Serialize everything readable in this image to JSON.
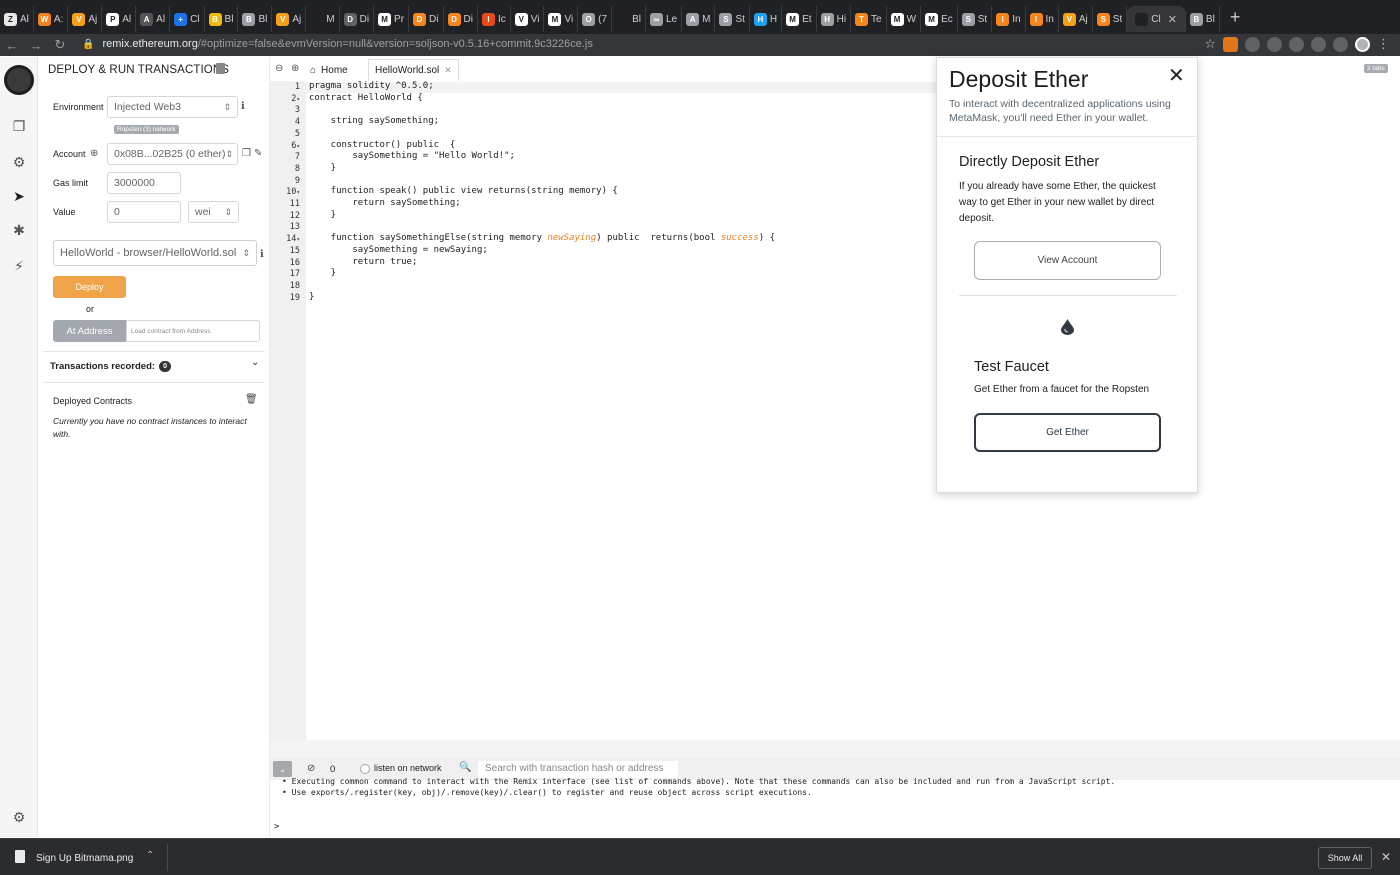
{
  "browser": {
    "tabs": [
      {
        "title": "Al",
        "color": "#e8e8e8",
        "glyph": "Z"
      },
      {
        "title": "A:",
        "color": "#f38020",
        "glyph": "W"
      },
      {
        "title": "Aj",
        "color": "#f6a01a",
        "glyph": "V"
      },
      {
        "title": "Al",
        "color": "#ffffff",
        "glyph": "P"
      },
      {
        "title": "Al",
        "color": "#555555",
        "glyph": "A"
      },
      {
        "title": "Cl",
        "color": "#1a73e8",
        "glyph": "+"
      },
      {
        "title": "Bl",
        "color": "#f0b90b",
        "glyph": "B"
      },
      {
        "title": "Bl",
        "color": "#9aa0a6",
        "glyph": "B"
      },
      {
        "title": "Aj",
        "color": "#f6a01a",
        "glyph": "V"
      },
      {
        "title": "M",
        "color": "#202124",
        "glyph": ""
      },
      {
        "title": "Di",
        "color": "#5f6368",
        "glyph": "D"
      },
      {
        "title": "Pr",
        "color": "#ffffff",
        "glyph": "M"
      },
      {
        "title": "Di",
        "color": "#f6851b",
        "glyph": "D"
      },
      {
        "title": "Di",
        "color": "#f6851b",
        "glyph": "D"
      },
      {
        "title": "Ic",
        "color": "#e64a19",
        "glyph": "I"
      },
      {
        "title": "Vi",
        "color": "#ffffff",
        "glyph": "V"
      },
      {
        "title": "Vi",
        "color": "#ffffff",
        "glyph": "M"
      },
      {
        "title": "(7",
        "color": "#9aa0a6",
        "glyph": "O"
      },
      {
        "title": "Bl",
        "color": "#202124",
        "glyph": ""
      },
      {
        "title": "Le",
        "color": "#9aa0a6",
        "glyph": "∞"
      },
      {
        "title": "M",
        "color": "#9aa0a6",
        "glyph": "A"
      },
      {
        "title": "St",
        "color": "#9aa0a6",
        "glyph": "S"
      },
      {
        "title": "H",
        "color": "#1da1f2",
        "glyph": "H"
      },
      {
        "title": "Et",
        "color": "#ffffff",
        "glyph": "M"
      },
      {
        "title": "Hi",
        "color": "#9aa0a6",
        "glyph": "H"
      },
      {
        "title": "Te",
        "color": "#f6851b",
        "glyph": "T"
      },
      {
        "title": "W",
        "color": "#ffffff",
        "glyph": "M"
      },
      {
        "title": "Ec",
        "color": "#ffffff",
        "glyph": "M"
      },
      {
        "title": "St",
        "color": "#9aa0a6",
        "glyph": "S"
      },
      {
        "title": "In",
        "color": "#f6851b",
        "glyph": "I"
      },
      {
        "title": "In",
        "color": "#f6851b",
        "glyph": "I"
      },
      {
        "title": "Aj",
        "color": "#f6a01a",
        "glyph": "V"
      },
      {
        "title": "St",
        "color": "#f6851b",
        "glyph": "S"
      },
      {
        "title": "Cl",
        "color": "#202124",
        "glyph": ""
      },
      {
        "title": "Bl",
        "color": "#9aa0a6",
        "glyph": "B"
      }
    ],
    "url_host": "remix.ethereum.org",
    "url_path": "/#optimize=false&evmVersion=null&version=soljson-v0.5.16+commit.9c3226ce.js"
  },
  "deploy_panel": {
    "title": "DEPLOY & RUN TRANSACTIONS",
    "environment_label": "Environment",
    "environment_value": "Injected Web3",
    "network_badge": "Ropsten (3) network",
    "account_label": "Account",
    "account_value": "0x08B...02B25 (0 ether)",
    "gas_limit_label": "Gas limit",
    "gas_limit_value": "3000000",
    "value_label": "Value",
    "value_amount": "0",
    "value_unit": "wei",
    "contract_select": "HelloWorld - browser/HelloWorld.sol",
    "deploy_button": "Deploy",
    "or_label": "or",
    "at_address_button": "At Address",
    "at_address_placeholder": "Load contract from Address",
    "transactions_recorded_label": "Transactions recorded:",
    "transactions_recorded_count": "0",
    "deployed_contracts_label": "Deployed Contracts",
    "deployed_contracts_empty": "Currently you have no contract instances to interact with."
  },
  "editor": {
    "home_tab": "Home",
    "file_tab": "HelloWorld.sol",
    "tab_count_badge": "2 tabs",
    "lines": [
      {
        "n": "1",
        "fold": "",
        "parts": [
          {
            "t": "pragma solidity ^0.5.0;",
            "c": ""
          }
        ]
      },
      {
        "n": "2",
        "fold": "▾",
        "parts": [
          {
            "t": "contract HelloWorld {",
            "c": ""
          }
        ]
      },
      {
        "n": "3",
        "fold": "",
        "parts": []
      },
      {
        "n": "4",
        "fold": "",
        "parts": [
          {
            "t": "    string saySomething;",
            "c": ""
          }
        ]
      },
      {
        "n": "5",
        "fold": "",
        "parts": []
      },
      {
        "n": "6",
        "fold": "▾",
        "parts": [
          {
            "t": "    constructor() public  {",
            "c": ""
          }
        ]
      },
      {
        "n": "7",
        "fold": "",
        "parts": [
          {
            "t": "        saySomething = \"Hello World!\";",
            "c": ""
          }
        ]
      },
      {
        "n": "8",
        "fold": "",
        "parts": [
          {
            "t": "    }",
            "c": ""
          }
        ]
      },
      {
        "n": "9",
        "fold": "",
        "parts": []
      },
      {
        "n": "10",
        "fold": "▾",
        "parts": [
          {
            "t": "    function speak() public view returns(string memory) {",
            "c": ""
          }
        ]
      },
      {
        "n": "11",
        "fold": "",
        "parts": [
          {
            "t": "        return saySomething;",
            "c": ""
          }
        ]
      },
      {
        "n": "12",
        "fold": "",
        "parts": [
          {
            "t": "    }",
            "c": ""
          }
        ]
      },
      {
        "n": "13",
        "fold": "",
        "parts": []
      },
      {
        "n": "14",
        "fold": "▾",
        "parts": [
          {
            "t": "    function saySomethingElse(string memory ",
            "c": ""
          },
          {
            "t": "newSaying",
            "c": "it"
          },
          {
            "t": ") public  returns(bool ",
            "c": ""
          },
          {
            "t": "success",
            "c": "it"
          },
          {
            "t": ") {",
            "c": ""
          }
        ]
      },
      {
        "n": "15",
        "fold": "",
        "parts": [
          {
            "t": "        saySomething = newSaying;",
            "c": ""
          }
        ]
      },
      {
        "n": "16",
        "fold": "",
        "parts": [
          {
            "t": "        return true;",
            "c": ""
          }
        ]
      },
      {
        "n": "17",
        "fold": "",
        "parts": [
          {
            "t": "    }",
            "c": ""
          }
        ]
      },
      {
        "n": "18",
        "fold": "",
        "parts": []
      },
      {
        "n": "19",
        "fold": "",
        "parts": [
          {
            "t": "}",
            "c": ""
          }
        ]
      }
    ]
  },
  "terminal": {
    "count": "0",
    "listen_label": "listen on network",
    "search_placeholder": "Search with transaction hash or address",
    "lines": [
      "• Executing common command to interact with the Remix interface (see list of commands above). Note that these commands can also be included and run from a JavaScript script.",
      "• Use exports/.register(key, obj)/.remove(key)/.clear() to register and reuse object across script executions."
    ],
    "prompt": ">"
  },
  "metamask_popup": {
    "title": "Deposit Ether",
    "close_glyph": "✕",
    "intro": "To interact with decentralized applications using MetaMask, you'll need Ether in your wallet.",
    "direct_title": "Directly Deposit Ether",
    "direct_text": "If you already have some Ether, the quickest way to get Ether in your new wallet by direct deposit.",
    "view_account_button": "View Account",
    "faucet_title": "Test Faucet",
    "faucet_text": "Get Ether from a faucet for the Ropsten",
    "get_ether_button": "Get Ether"
  },
  "download_bar": {
    "file_name": "Sign Up Bitmama.png",
    "show_all_button": "Show All"
  }
}
